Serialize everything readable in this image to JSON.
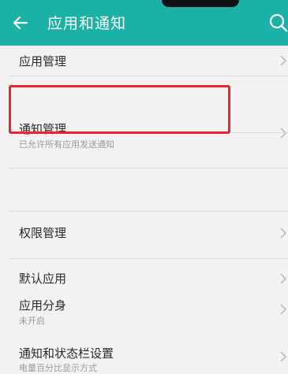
{
  "header": {
    "title": "应用和通知",
    "back_icon": "arrow-left-icon",
    "search_icon": "search-icon",
    "color": "#1cb1a6"
  },
  "items": [
    {
      "label": "应用管理"
    },
    {
      "label": "通知管理",
      "subtitle": "已允许所有应用发送通知",
      "highlighted": true
    },
    {
      "label": "权限管理"
    },
    {
      "label": "默认应用"
    },
    {
      "label": "应用分身",
      "subtitle": "未开启"
    },
    {
      "label": "通知和状态栏设置",
      "subtitle": "电量百分比显示方式"
    }
  ],
  "highlight_color": "#f0232a"
}
